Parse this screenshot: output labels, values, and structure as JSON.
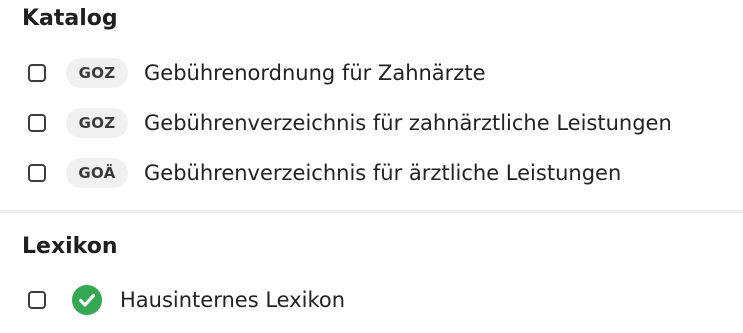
{
  "katalog": {
    "title": "Katalog",
    "items": [
      {
        "badge": "GOZ",
        "label": "Gebührenordnung für Zahnärzte",
        "checked": false
      },
      {
        "badge": "GOZ",
        "label": "Gebührenverzeichnis für zahnärztliche Leistungen",
        "checked": false
      },
      {
        "badge": "GOÄ",
        "label": "Gebührenverzeichnis für ärztliche Leistungen",
        "checked": false
      }
    ]
  },
  "lexikon": {
    "title": "Lexikon",
    "items": [
      {
        "icon": "check-circle-icon",
        "label": "Hausinternes Lexikon",
        "checked": false
      }
    ]
  },
  "colors": {
    "check_green": "#34a853",
    "badge_bg": "#f0f0f0",
    "divider": "#eeeeee"
  }
}
